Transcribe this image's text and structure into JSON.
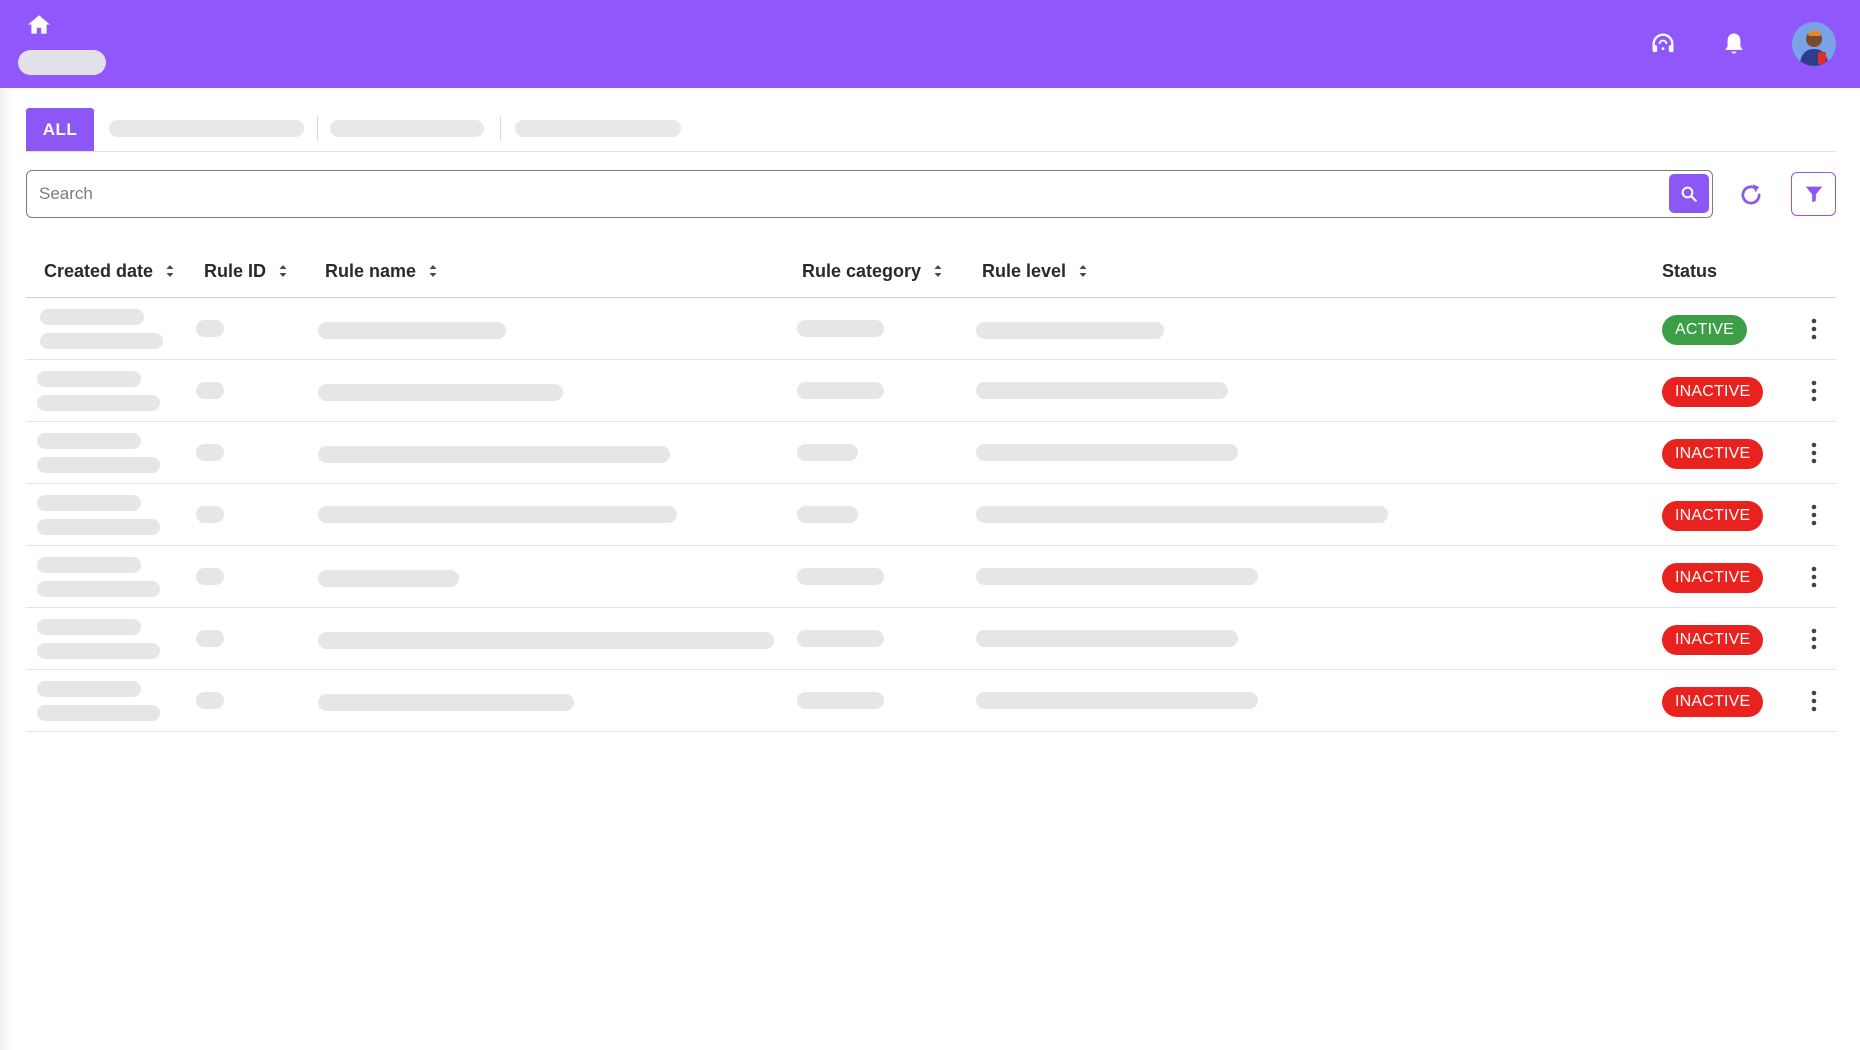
{
  "colors": {
    "topbar": "#9057fb",
    "accent": "#8d57f5",
    "status_active": "#3d9e48",
    "status_inactive": "#e8231f",
    "skeleton": "#e6e6e6"
  },
  "topbar": {
    "home_icon": "home-icon",
    "support_icon": "headset-icon",
    "notifications_icon": "bell-icon",
    "avatar": "user-avatar"
  },
  "tabs": {
    "active_label": "ALL"
  },
  "search": {
    "placeholder": "Search",
    "value": "",
    "button_icon": "search-icon"
  },
  "toolbar": {
    "refresh_icon": "refresh-icon",
    "filter_icon": "filter-icon"
  },
  "table": {
    "columns": [
      {
        "label": "Created date",
        "sortable": true
      },
      {
        "label": "Rule ID",
        "sortable": true
      },
      {
        "label": "Rule name",
        "sortable": true
      },
      {
        "label": "Rule category",
        "sortable": true
      },
      {
        "label": "Rule level",
        "sortable": true
      },
      {
        "label": "Status",
        "sortable": false
      }
    ],
    "rows": [
      {
        "status": "ACTIVE"
      },
      {
        "status": "INACTIVE"
      },
      {
        "status": "INACTIVE"
      },
      {
        "status": "INACTIVE"
      },
      {
        "status": "INACTIVE"
      },
      {
        "status": "INACTIVE"
      },
      {
        "status": "INACTIVE"
      }
    ],
    "row_menu_icon": "more-vertical-icon"
  }
}
